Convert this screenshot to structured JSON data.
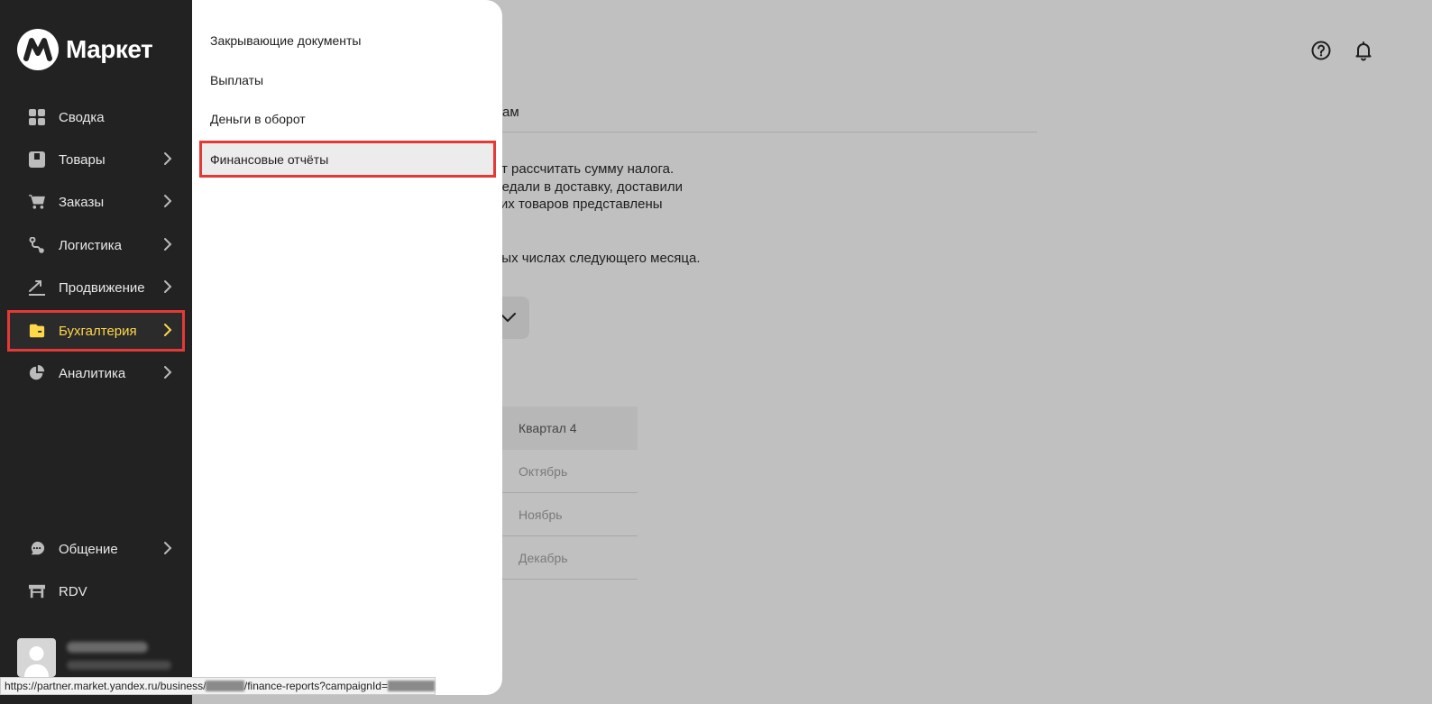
{
  "sidebar": {
    "logo_text": "Маркет",
    "items": [
      {
        "label": "Сводка",
        "icon": "dashboard-icon",
        "has_chevron": false
      },
      {
        "label": "Товары",
        "icon": "box-icon",
        "has_chevron": true
      },
      {
        "label": "Заказы",
        "icon": "cart-icon",
        "has_chevron": true
      },
      {
        "label": "Логистика",
        "icon": "route-icon",
        "has_chevron": true
      },
      {
        "label": "Продвижение",
        "icon": "trend-icon",
        "has_chevron": true
      },
      {
        "label": "Бухгалтерия",
        "icon": "wallet-icon",
        "has_chevron": true,
        "active": true
      },
      {
        "label": "Аналитика",
        "icon": "pie-chart-icon",
        "has_chevron": true
      },
      {
        "label": "Общение",
        "icon": "chat-icon",
        "has_chevron": true
      },
      {
        "label": "RDV",
        "icon": "store-icon",
        "has_chevron": false
      }
    ],
    "active_color": "#ffd84a"
  },
  "submenu": {
    "items": [
      {
        "label": "Закрывающие документы"
      },
      {
        "label": "Выплаты"
      },
      {
        "label": "Деньги в оборот"
      },
      {
        "label": "Финансовые отчёты",
        "active": true
      }
    ]
  },
  "main": {
    "tab_fragment": "ам",
    "paragraph_lines": [
      "яет рассчитать сумму налога.",
      "ередали в доставку, доставили",
      "аких товаров представлены"
    ],
    "note_line": "овых числах следующего месяца.",
    "period_table": {
      "header": "Квартал 4",
      "rows": [
        "Октябрь",
        "Ноябрь",
        "Декабрь"
      ]
    }
  },
  "header_icons": [
    "help-icon",
    "bell-icon"
  ],
  "statusbar": {
    "url_part1": "https://partner.market.yandex.ru/business/",
    "url_part2": "/finance-reports?campaignId="
  },
  "colors": {
    "sidebar_bg": "#222222",
    "highlight_border": "#e53935",
    "overlay_bg": "#c0c0c0"
  }
}
